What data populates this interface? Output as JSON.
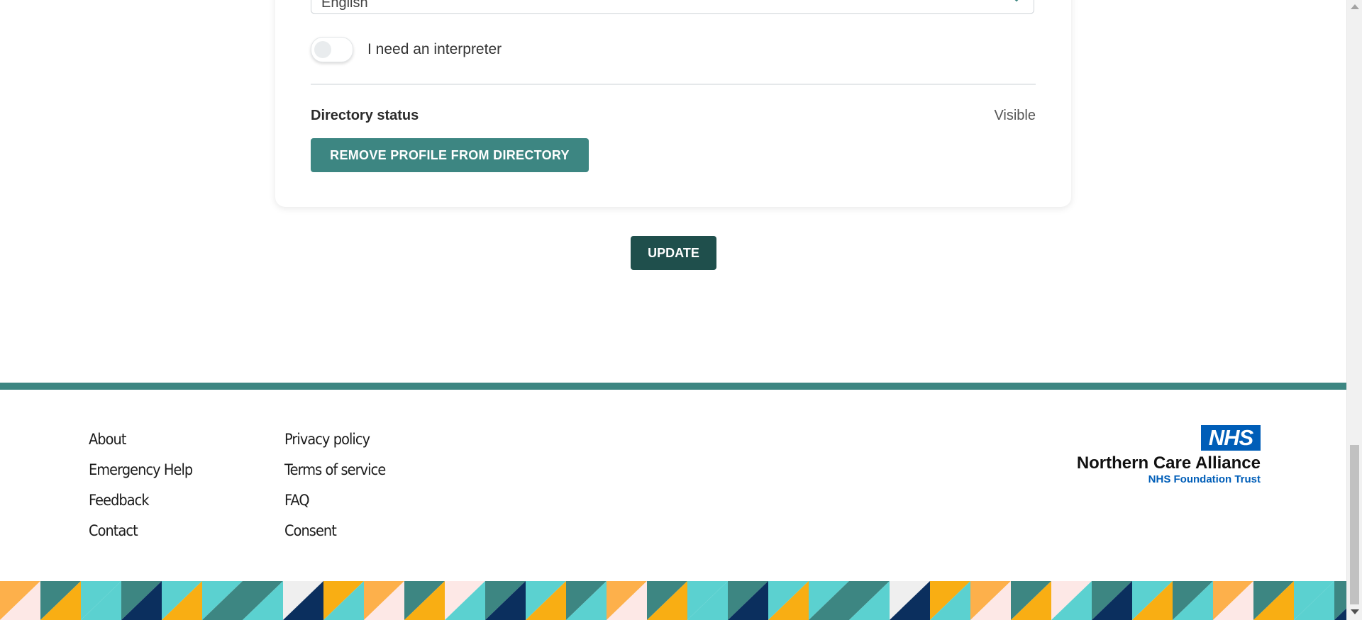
{
  "language_select": {
    "value": "English",
    "icon": "chevron-down-icon"
  },
  "interpreter": {
    "label": "I need an interpreter",
    "enabled": false
  },
  "directory": {
    "status_label": "Directory status",
    "status_value": "Visible",
    "remove_button": "REMOVE PROFILE FROM DIRECTORY"
  },
  "update_button": "UPDATE",
  "footer": {
    "col1": [
      "About",
      "Emergency Help",
      "Feedback",
      "Contact"
    ],
    "col2": [
      "Privacy policy",
      "Terms of service",
      "FAQ",
      "Consent"
    ],
    "logo": {
      "badge": "NHS",
      "name": "Northern Care Alliance",
      "subtitle": "NHS Foundation Trust"
    }
  },
  "colors": {
    "teal": "#3d8682",
    "dark_teal": "#1f4f4c",
    "nhs_blue": "#005eb8",
    "pattern": [
      "#3d8682",
      "#5bd1d0",
      "#0b2f5e",
      "#f9ae13",
      "#fdb04b",
      "#fde8e6",
      "#efefef"
    ]
  }
}
